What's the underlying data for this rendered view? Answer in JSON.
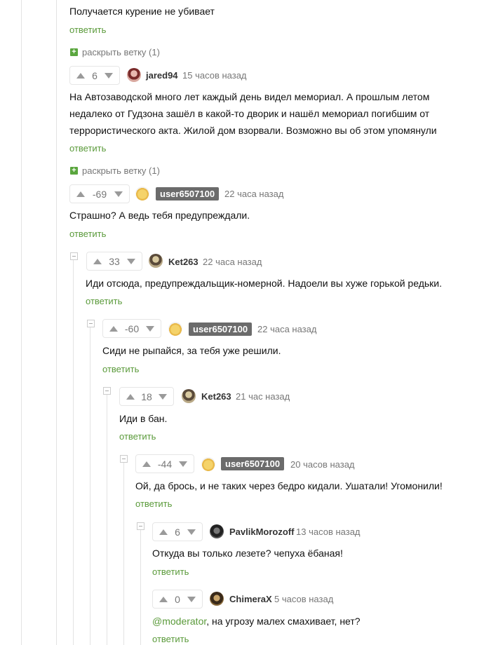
{
  "top_comment": {
    "text": "Получается курение не убивает",
    "reply": "ответить"
  },
  "expand_labels": [
    "раскрыть ветку (1)",
    "раскрыть ветку (1)"
  ],
  "comments": [
    {
      "score": "6",
      "user": "jared94",
      "time": "15 часов назад",
      "lines": [
        "На Автозаводской много лет каждый день видел мемориал. А прошлым летом",
        "недалеко от Гудзона зашёл в какой-то дворик и нашёл мемориал погибшим от",
        "террористического акта. Жилой дом взорвали. Возможно вы об этом упомянули"
      ],
      "reply": "ответить"
    },
    {
      "score": "-69",
      "user": "user6507100",
      "time": "22 часа назад",
      "text": "Страшно? А ведь тебя предупреждали.",
      "reply": "ответить"
    },
    {
      "score": "33",
      "user": "Ket263",
      "time": "22 часа назад",
      "text": "Иди отсюда, предупреждальщик-номерной. Надоели вы хуже горькой редьки.",
      "reply": "ответить"
    },
    {
      "score": "-60",
      "user": "user6507100",
      "time": "22 часа назад",
      "text": "Сиди не рыпайся, за тебя уже решили.",
      "reply": "ответить"
    },
    {
      "score": "18",
      "user": "Ket263",
      "time": "21 час назад",
      "text": "Иди в бан.",
      "reply": "ответить"
    },
    {
      "score": "-44",
      "user": "user6507100",
      "time": "20 часов назад",
      "text": "Ой, да брось, и не таких через бедро кидали. Ушатали! Угомонили!",
      "reply": "ответить"
    },
    {
      "score": "6",
      "user": "PavlikMorozoff",
      "time": "13 часов назад",
      "text": "Откуда вы только лезете? чепуха ёбаная!",
      "reply": "ответить"
    },
    {
      "score": "0",
      "user": "ChimeraX",
      "time": "5 часов назад",
      "mention": "@moderator",
      "text": ", на угрозу малех смахивает, нет?",
      "reply": "ответить"
    }
  ],
  "colors": {
    "accent": "#5a9a3a",
    "badge": "#6b6b6b"
  },
  "icons": {
    "vote_up": "triangle-up-icon",
    "vote_down": "triangle-down-icon",
    "expand": "plus-icon",
    "collapse": "minus-box-icon"
  }
}
